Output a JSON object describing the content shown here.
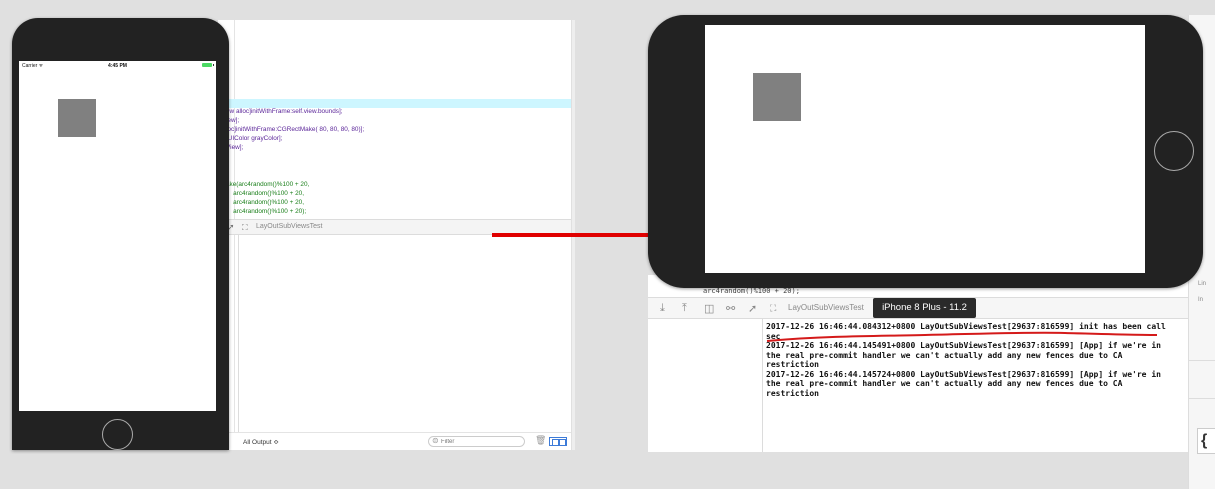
{
  "left_simulator": {
    "status_bar": {
      "carrier": "Carrier ᯤ",
      "time": "4:45 PM"
    }
  },
  "left_xcode": {
    "code_lines": [
      "ew alloc]initWithFrame:self.view.bounds];",
      "iew];",
      "loc]initWithFrame:CGRectMake( 80, 80, 80, 80)];",
      "[UIColor grayColor];",
      "View];",
      "",
      "",
      "",
      "ake(arc4random()%100 + 20,",
      "    arc4random()%100 + 20,",
      "    arc4random()%100 + 20,",
      "    arc4random()%100 + 20);"
    ],
    "debug_bar": {
      "scheme_label": "LayOutSubViewsTest"
    },
    "bottom_bar": {
      "output_selector": "All Output ≎",
      "filter_placeholder": "Filter"
    }
  },
  "right_xcode": {
    "code_peek": "arc4random()%100 + 20);",
    "debug_bar": {
      "scheme_label": "LayOutSubViewsTest"
    },
    "device_tooltip": "iPhone 8 Plus - 11.2",
    "console_log": "2017-12-26 16:46:44.084312+0800 LayOutSubViewsTest[29637:816599] init has been call\nsec\n2017-12-26 16:46:44.145491+0800 LayOutSubViewsTest[29637:816599] [App] if we're in\nthe real pre-commit handler we can't actually add any new fences due to CA\nrestriction\n2017-12-26 16:46:44.145724+0800 LayOutSubViewsTest[29637:816599] [App] if we're in\nthe real pre-commit handler we can't actually add any new fences due to CA\nrestriction",
    "side_strip": {
      "labels": [
        "Lin",
        "In"
      ],
      "brace_glyph": "{"
    }
  },
  "colors": {
    "highlight_line": "#cdf6ff",
    "gray_view": "#808080",
    "arrow": "#e00000",
    "underline": "#d41a1a",
    "battery": "#4cd964",
    "phone_body": "#222222",
    "split_view_icon": "#3d7bd8"
  },
  "icons": {
    "left_debug": [
      "location-arrow-icon",
      "scheme-icon"
    ],
    "right_debug": [
      "step-over-icon",
      "step-out-icon",
      "view-hierarchy-icon",
      "memory-graph-icon",
      "location-arrow-icon",
      "scheme-icon"
    ],
    "bottom": [
      "search-icon",
      "trash-icon",
      "split-view-icon"
    ]
  }
}
